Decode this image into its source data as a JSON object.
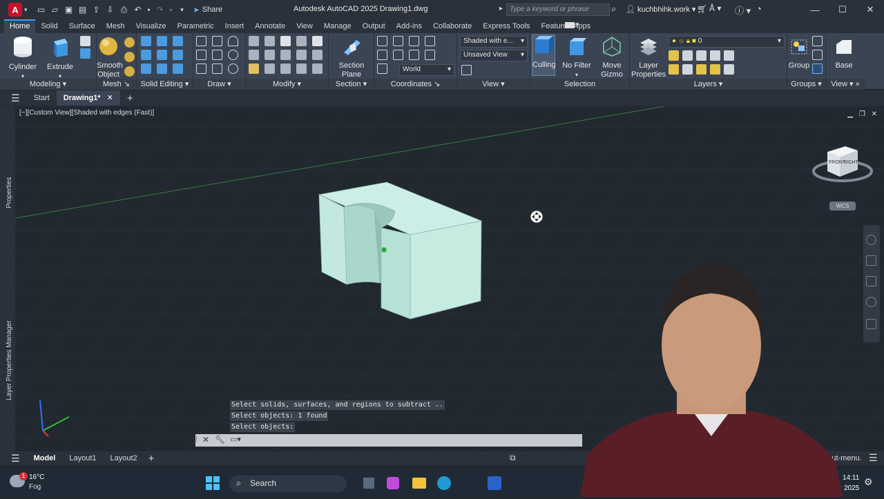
{
  "app": {
    "logo_letter": "A",
    "title": "Autodesk AutoCAD 2025    Drawing1.dwg",
    "share_label": "Share",
    "search_placeholder": "Type a keyword or phrase",
    "user": "kuchbhihk.work"
  },
  "ribbon_tabs": [
    "Home",
    "Solid",
    "Surface",
    "Mesh",
    "Visualize",
    "Parametric",
    "Insert",
    "Annotate",
    "View",
    "Manage",
    "Output",
    "Add-ins",
    "Collaborate",
    "Express Tools",
    "Featured Apps"
  ],
  "active_tab": "Home",
  "ribbon": {
    "cylinder": "Cylinder",
    "extrude": "Extrude",
    "smooth_object": "Smooth\nObject",
    "section_plane": "Section\nPlane",
    "culling": "Culling",
    "no_filter": "No Filter",
    "move_gizmo": "Move\nGizmo",
    "layer_properties": "Layer\nProperties",
    "group": "Group",
    "base": "Base",
    "visual_style": "Shaded with e...",
    "saved_view": "Unsaved View",
    "ucs": "World",
    "layer_value": "0",
    "panels": {
      "modeling": "Modeling",
      "mesh": "Mesh",
      "solid_editing": "Solid Editing",
      "draw": "Draw",
      "modify": "Modify",
      "section": "Section",
      "coordinates": "Coordinates",
      "view": "View",
      "selection": "Selection",
      "layers": "Layers",
      "groups": "Groups",
      "view2": "View"
    }
  },
  "doc_tabs": {
    "start": "Start",
    "drawing": "Drawing1*"
  },
  "viewport": {
    "label": "[−][Custom View][Shaded with edges (Fast)]",
    "viewcube_front": "FRONT",
    "viewcube_right": "RIGHT",
    "wcs": "WCS",
    "side_properties": "Properties",
    "side_layers": "Layer Properties Manager"
  },
  "command_history": [
    "Select solids, surfaces, and regions to subtract ..",
    "Select objects: 1 found",
    "Select objects:"
  ],
  "status": {
    "model": "Model",
    "layout1": "Layout1",
    "layout2": "Layout2",
    "shortcut": "ortcut-menu."
  },
  "taskbar": {
    "temp": "16°C",
    "weather": "Fog",
    "search": "Search",
    "time": "14:11",
    "year": "2025"
  },
  "colors": {
    "accent": "#3aa0ff",
    "solid_face": "#bfe6dd",
    "viewport_bg": "#212830"
  }
}
